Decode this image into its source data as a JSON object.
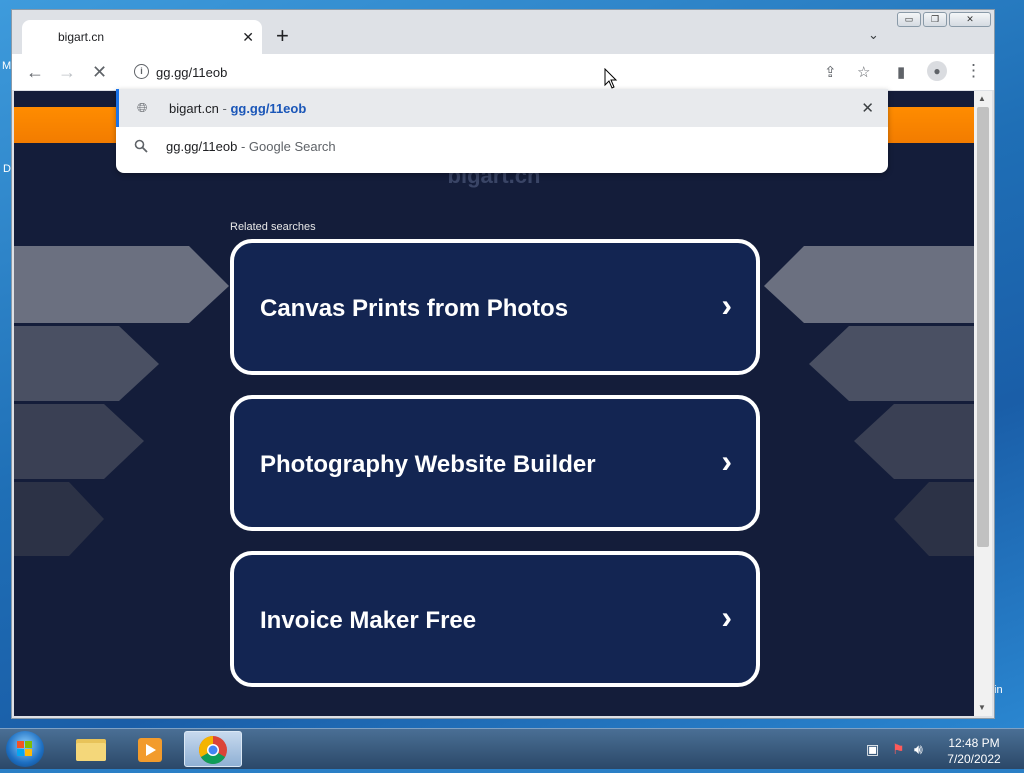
{
  "desktop": {
    "left_labels": [
      "M",
      "D"
    ],
    "right_label": "in"
  },
  "browser": {
    "tab": {
      "title": "bigart.cn",
      "close_glyph": "✕"
    },
    "new_tab_glyph": "+",
    "tab_menu_glyph": "⌄",
    "window_controls": {
      "minimize": "▭",
      "restore": "❐",
      "close": "✕"
    },
    "toolbar": {
      "back_glyph": "←",
      "forward_glyph": "→",
      "stop_glyph": "✕",
      "address_value": "gg.gg/11eob",
      "info_glyph": "i",
      "share_glyph": "⇪",
      "bookmark_glyph": "☆",
      "sidepanel_glyph": "▮",
      "profile_glyph": "●",
      "menu_glyph": "⋮"
    },
    "suggestions": [
      {
        "icon": "globe-icon",
        "site": "bigart.cn",
        "separator": " - ",
        "url": "gg.gg/11eob",
        "remove_glyph": "✕"
      },
      {
        "icon": "search-icon",
        "query": "gg.gg/11eob",
        "separator": " - ",
        "engine": "Google Search"
      }
    ]
  },
  "page": {
    "brand": "bigart.cn",
    "related_label": "Related searches",
    "cards": [
      {
        "label": "Canvas Prints from Photos",
        "chevron": "›"
      },
      {
        "label": "Photography Website Builder",
        "chevron": "›"
      },
      {
        "label": "Invoice Maker Free",
        "chevron": "›"
      }
    ],
    "colors": {
      "background": "#141d3a",
      "orange": "#ff8c00",
      "card": "#132552"
    }
  },
  "taskbar": {
    "time": "12:48 PM",
    "date": "7/20/2022",
    "apps": [
      "file-explorer-icon",
      "media-player-icon",
      "chrome-icon"
    ]
  }
}
